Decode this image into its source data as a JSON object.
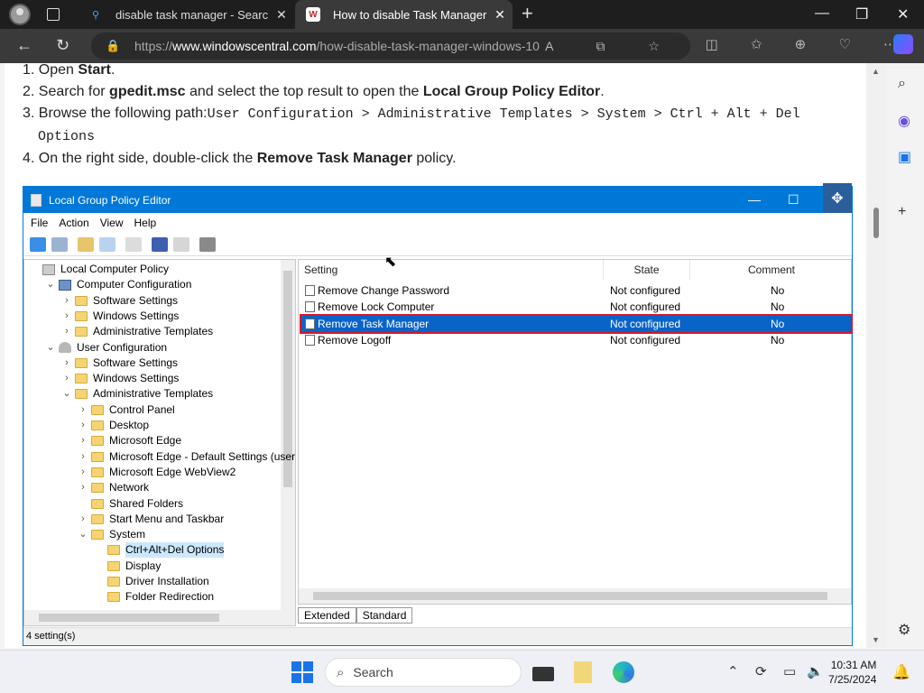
{
  "browser": {
    "tabs": [
      {
        "label": "disable task manager - Search",
        "icon": "search-icon"
      },
      {
        "label": "How to disable Task Manager on",
        "icon": "windows-central-icon"
      }
    ],
    "url_prefix": "https://",
    "url_domain": "www.windowscentral.com",
    "url_path": "/how-disable-task-manager-windows-10"
  },
  "article": {
    "step1_pre": "1. Open ",
    "step1_bold": "Start",
    "step1_post": ".",
    "step2_pre": "2. Search for ",
    "step2_bold": "gpedit.msc",
    "step2_mid": " and select the top result to open the ",
    "step2_bold2": "Local Group Policy Editor",
    "step2_post": ".",
    "step3_pre": "3. Browse the following path:",
    "step3_path1": "User Configuration > Administrative Templates > System > Ctrl + Alt + Del",
    "step3_path2": "Options",
    "step4_pre": "4. On the right side, double-click the ",
    "step4_bold": "Remove Task Manager",
    "step4_post": " policy."
  },
  "gpe": {
    "title": "Local Group Policy Editor",
    "menu": [
      "File",
      "Action",
      "View",
      "Help"
    ],
    "tree": [
      {
        "label": "Local Computer Policy",
        "level": 0,
        "icon": "pc",
        "chev": ""
      },
      {
        "label": "Computer Configuration",
        "level": 1,
        "icon": "cmp",
        "chev": "⌄"
      },
      {
        "label": "Software Settings",
        "level": 2,
        "icon": "fold",
        "chev": "›"
      },
      {
        "label": "Windows Settings",
        "level": 2,
        "icon": "fold",
        "chev": "›"
      },
      {
        "label": "Administrative Templates",
        "level": 2,
        "icon": "fold",
        "chev": "›"
      },
      {
        "label": "User Configuration",
        "level": 1,
        "icon": "usr",
        "chev": "⌄"
      },
      {
        "label": "Software Settings",
        "level": 2,
        "icon": "fold",
        "chev": "›"
      },
      {
        "label": "Windows Settings",
        "level": 2,
        "icon": "fold",
        "chev": "›"
      },
      {
        "label": "Administrative Templates",
        "level": 2,
        "icon": "fold",
        "chev": "⌄"
      },
      {
        "label": "Control Panel",
        "level": 3,
        "icon": "fold",
        "chev": "›"
      },
      {
        "label": "Desktop",
        "level": 3,
        "icon": "fold",
        "chev": "›"
      },
      {
        "label": "Microsoft Edge",
        "level": 3,
        "icon": "fold",
        "chev": "›"
      },
      {
        "label": "Microsoft Edge - Default Settings (users",
        "level": 3,
        "icon": "fold",
        "chev": "›"
      },
      {
        "label": "Microsoft Edge WebView2",
        "level": 3,
        "icon": "fold",
        "chev": "›"
      },
      {
        "label": "Network",
        "level": 3,
        "icon": "fold",
        "chev": "›"
      },
      {
        "label": "Shared Folders",
        "level": 3,
        "icon": "fold",
        "chev": ""
      },
      {
        "label": "Start Menu and Taskbar",
        "level": 3,
        "icon": "fold",
        "chev": "›"
      },
      {
        "label": "System",
        "level": 3,
        "icon": "fold",
        "chev": "⌄"
      },
      {
        "label": "Ctrl+Alt+Del Options",
        "level": 4,
        "icon": "fold",
        "chev": "",
        "selected": true
      },
      {
        "label": "Display",
        "level": 4,
        "icon": "fold",
        "chev": ""
      },
      {
        "label": "Driver Installation",
        "level": 4,
        "icon": "fold",
        "chev": ""
      },
      {
        "label": "Folder Redirection",
        "level": 4,
        "icon": "fold",
        "chev": ""
      }
    ],
    "columns": [
      "Setting",
      "State",
      "Comment"
    ],
    "rows": [
      {
        "setting": "Remove Change Password",
        "state": "Not configured",
        "comment": "No"
      },
      {
        "setting": "Remove Lock Computer",
        "state": "Not configured",
        "comment": "No"
      },
      {
        "setting": "Remove Task Manager",
        "state": "Not configured",
        "comment": "No",
        "selected": true
      },
      {
        "setting": "Remove Logoff",
        "state": "Not configured",
        "comment": "No"
      }
    ],
    "view_tabs": [
      "Extended",
      "Standard"
    ],
    "status": "4 setting(s)"
  },
  "taskbar": {
    "search_placeholder": "Search",
    "time": "10:31 AM",
    "date": "7/25/2024"
  }
}
